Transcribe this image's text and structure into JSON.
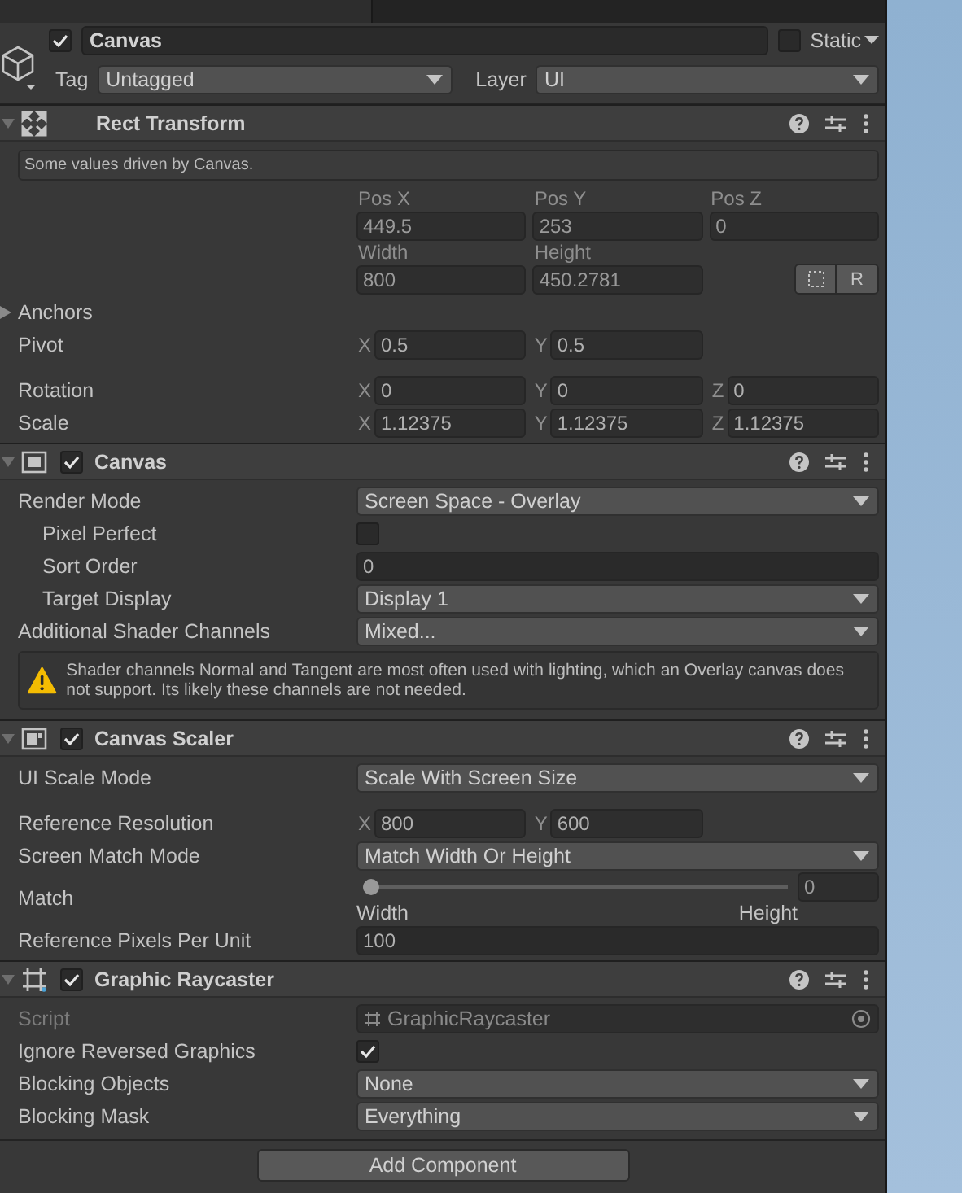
{
  "object": {
    "active": true,
    "name": "Canvas",
    "static": false,
    "static_label": "Static",
    "tag_label": "Tag",
    "tag": "Untagged",
    "layer_label": "Layer",
    "layer": "UI"
  },
  "components": [
    {
      "title": "Rect Transform",
      "kind": "transform",
      "expanded": true,
      "rows": [
        {
          "kind": "info",
          "text": "Some values driven by Canvas."
        },
        {
          "kind": "labeled_fields",
          "fields": [
            {
              "label": "Pos X",
              "value": "449.5"
            },
            {
              "label": "Pos Y",
              "value": "253"
            },
            {
              "label": "Pos Z",
              "value": "0"
            }
          ]
        },
        {
          "kind": "labeled_fields",
          "fields": [
            {
              "label": "Width",
              "value": "800"
            },
            {
              "label": "Height",
              "value": "450.2781"
            }
          ],
          "raw_button": "R"
        },
        {
          "kind": "foldout",
          "label": "Anchors",
          "expanded": false
        },
        {
          "kind": "vector",
          "label": "Pivot",
          "values": [
            {
              "axis": "X",
              "value": "0.5"
            },
            {
              "axis": "Y",
              "value": "0.5"
            }
          ]
        },
        {
          "kind": "spacer"
        },
        {
          "kind": "vector",
          "label": "Rotation",
          "values": [
            {
              "axis": "X",
              "value": "0"
            },
            {
              "axis": "Y",
              "value": "0"
            },
            {
              "axis": "Z",
              "value": "0"
            }
          ]
        },
        {
          "kind": "vector",
          "label": "Scale",
          "values": [
            {
              "axis": "X",
              "value": "1.12375"
            },
            {
              "axis": "Y",
              "value": "1.12375"
            },
            {
              "axis": "Z",
              "value": "1.12375"
            }
          ]
        }
      ]
    },
    {
      "title": "Canvas",
      "kind": "canvas",
      "enabled": true,
      "expanded": true,
      "rows": [
        {
          "kind": "dropdown",
          "label": "Render Mode",
          "value": "Screen Space - Overlay"
        },
        {
          "kind": "checkbox",
          "label": "Pixel Perfect",
          "checked": false,
          "indent": true
        },
        {
          "kind": "number",
          "label": "Sort Order",
          "value": "0",
          "indent": true
        },
        {
          "kind": "dropdown",
          "label": "Target Display",
          "value": "Display 1",
          "indent": true
        },
        {
          "kind": "dropdown",
          "label": "Additional Shader Channels",
          "value": "Mixed..."
        },
        {
          "kind": "warning",
          "text": "Shader channels Normal and Tangent are most often used with lighting, which an Overlay canvas does not support. Its likely these channels are not needed."
        }
      ]
    },
    {
      "title": "Canvas Scaler",
      "kind": "scaler",
      "enabled": true,
      "expanded": true,
      "rows": [
        {
          "kind": "dropdown",
          "label": "UI Scale Mode",
          "value": "Scale With Screen Size"
        },
        {
          "kind": "spacer"
        },
        {
          "kind": "vector",
          "label": "Reference Resolution",
          "values": [
            {
              "axis": "X",
              "value": "800"
            },
            {
              "axis": "Y",
              "value": "600"
            }
          ]
        },
        {
          "kind": "dropdown",
          "label": "Screen Match Mode",
          "value": "Match Width Or Height"
        },
        {
          "kind": "slider",
          "label": "Match",
          "level": 0,
          "value": "0",
          "min_label": "Width",
          "max_label": "Height"
        },
        {
          "kind": "number",
          "label": "Reference Pixels Per Unit",
          "value": "100"
        }
      ]
    },
    {
      "title": "Graphic Raycaster",
      "kind": "raycaster",
      "enabled": true,
      "expanded": true,
      "rows": [
        {
          "kind": "object",
          "label": "Script",
          "value": "GraphicRaycaster",
          "disabled": true
        },
        {
          "kind": "checkbox",
          "label": "Ignore Reversed Graphics",
          "checked": true
        },
        {
          "kind": "dropdown",
          "label": "Blocking Objects",
          "value": "None"
        },
        {
          "kind": "dropdown",
          "label": "Blocking Mask",
          "value": "Everything"
        }
      ]
    }
  ],
  "add_button": "Add Component"
}
